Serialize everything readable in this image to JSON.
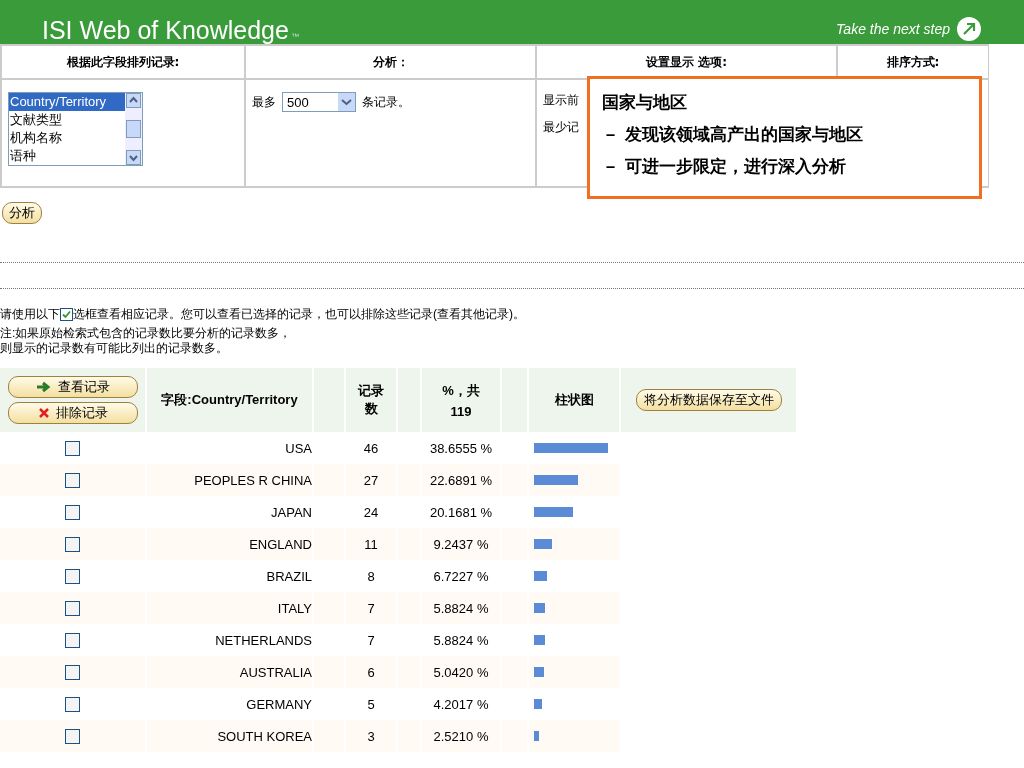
{
  "header": {
    "title": "ISI Web of Knowledge",
    "trademark": "™",
    "tagline": "Take the next step"
  },
  "settings": {
    "columns": [
      "根据此字段排列记录:",
      "分析：",
      "设置显示 选项:",
      "排序方式:"
    ],
    "field_list": [
      {
        "label": "Country/Territory",
        "selected": true
      },
      {
        "label": "文献类型",
        "selected": false
      },
      {
        "label": "机构名称",
        "selected": false
      },
      {
        "label": "语种",
        "selected": false
      }
    ],
    "max_prefix": "最多",
    "max_value": "500",
    "max_suffix": "条记录。",
    "display_labels": [
      "显示前",
      "最少记"
    ]
  },
  "callout": {
    "title": "国家与地区",
    "points": [
      "－ 发现该领域高产出的国家与地区",
      "－ 可进一步限定，进行深入分析"
    ]
  },
  "analyze_button": "分析",
  "notes": {
    "line_before": "请使用以下",
    "line_after": "选框查看相应记录。您可以查看已选择的记录，也可以排除这些记录(查看其他记录)。",
    "lines": [
      "注:如果原始检索式包含的记录数比要分析的记录数多，",
      "则显示的记录数有可能比列出的记录数多。"
    ]
  },
  "results": {
    "view_button": "查看记录",
    "exclude_button": "排除记录",
    "field_header": "字段:Country/Territory",
    "count_header": "记录数",
    "percent_header": "%，共",
    "total": "119",
    "chart_header": "柱状图",
    "save_button": "将分析数据保存至文件",
    "rows": [
      {
        "name": "USA",
        "count": "46",
        "percent": "38.6555 %",
        "level": 0.93,
        "checked": false
      },
      {
        "name": "PEOPLES R CHINA",
        "count": "27",
        "percent": "22.6891 %",
        "level": 0.55,
        "checked": false
      },
      {
        "name": "JAPAN",
        "count": "24",
        "percent": "20.1681 %",
        "level": 0.49,
        "checked": false
      },
      {
        "name": "ENGLAND",
        "count": "11",
        "percent": "9.2437 %",
        "level": 0.22,
        "checked": false
      },
      {
        "name": "BRAZIL",
        "count": "8",
        "percent": "6.7227 %",
        "level": 0.16,
        "checked": false
      },
      {
        "name": "ITALY",
        "count": "7",
        "percent": "5.8824 %",
        "level": 0.14,
        "checked": false
      },
      {
        "name": "NETHERLANDS",
        "count": "7",
        "percent": "5.8824 %",
        "level": 0.14,
        "checked": false
      },
      {
        "name": "AUSTRALIA",
        "count": "6",
        "percent": "5.0420 %",
        "level": 0.12,
        "checked": false
      },
      {
        "name": "GERMANY",
        "count": "5",
        "percent": "4.2017 %",
        "level": 0.1,
        "checked": false
      },
      {
        "name": "SOUTH KOREA",
        "count": "3",
        "percent": "2.5210 %",
        "level": 0.06,
        "checked": false
      }
    ]
  }
}
